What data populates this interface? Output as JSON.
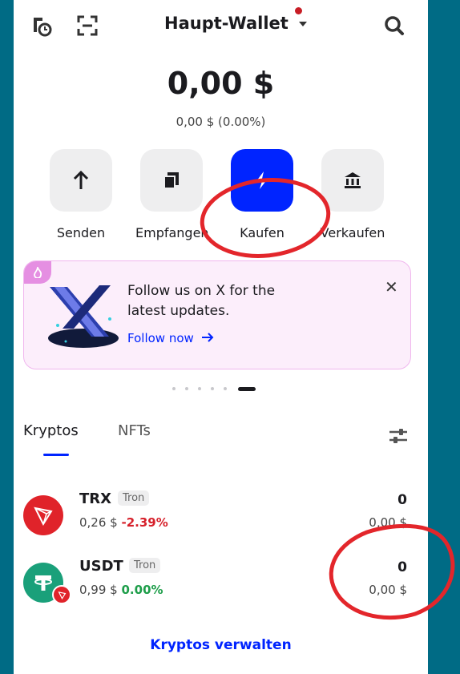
{
  "header": {
    "title": "Haupt-Wallet"
  },
  "balance": {
    "amount": "0,00 $",
    "sub": "0,00 $ (0.00%)"
  },
  "actions": [
    {
      "label": "Senden"
    },
    {
      "label": "Empfangen"
    },
    {
      "label": "Kaufen"
    },
    {
      "label": "Verkaufen"
    }
  ],
  "banner": {
    "text": "Follow us on X for the latest updates.",
    "link": "Follow now"
  },
  "tabs": [
    {
      "label": "Kryptos"
    },
    {
      "label": "NFTs"
    }
  ],
  "assets": [
    {
      "symbol": "TRX",
      "network": "Tron",
      "price": "0,26 $",
      "change": "-2.39%",
      "quantity": "0",
      "value": "0,00 $"
    },
    {
      "symbol": "USDT",
      "network": "Tron",
      "price": "0,99 $",
      "change": "0.00%",
      "quantity": "0",
      "value": "0,00 $"
    }
  ],
  "footer": {
    "manage_label": "Kryptos verwalten"
  },
  "colors": {
    "background": "#006b85",
    "accent": "#0024ff",
    "negative": "#d6202a",
    "positive": "#1e9e4a",
    "annotation": "#e3262b"
  },
  "icons": [
    "history-icon",
    "scan-icon",
    "search-icon",
    "arrow-up-icon",
    "copy-icon",
    "lightning-icon",
    "bank-icon",
    "flame-icon",
    "close-icon",
    "arrow-right-icon",
    "filter-icon",
    "tron-icon",
    "tether-icon"
  ]
}
